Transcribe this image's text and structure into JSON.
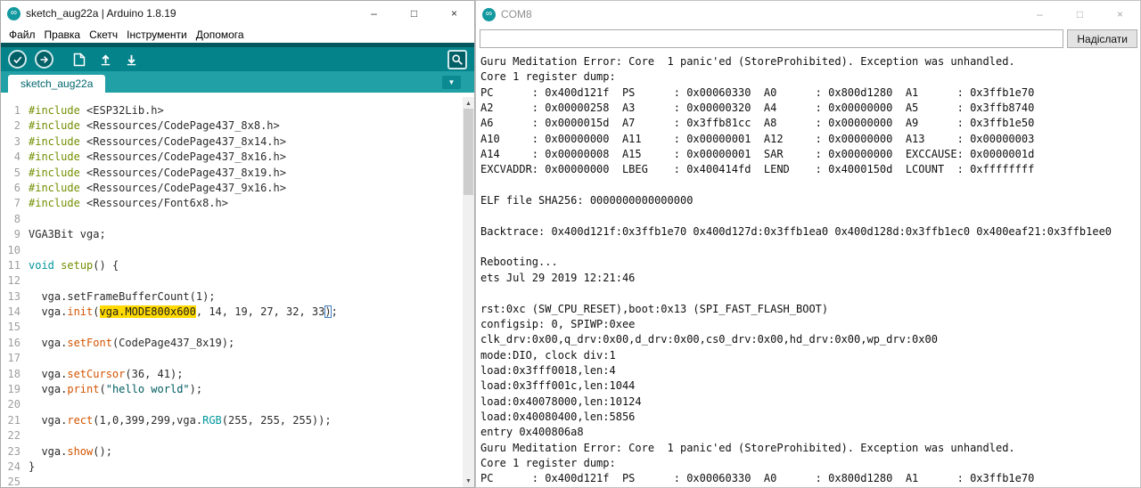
{
  "glyphs": {
    "infinity": "∞",
    "minimize": "–",
    "maximize": "□",
    "close": "×",
    "chevron_down": "▼",
    "scroll_up": "▲",
    "scroll_down": "▼"
  },
  "colors": {
    "toolbar_teal": "#04838A",
    "toolbar_dark_strip": "#02565C",
    "tabbar_teal": "#21A0A6",
    "keyword": "#00979C",
    "function": "#D35400",
    "directive": "#728E00",
    "string": "#005C5F",
    "selection_highlight": "#FFD900"
  },
  "ide": {
    "title": "sketch_aug22a | Arduino 1.8.19",
    "menu": [
      "Файл",
      "Правка",
      "Скетч",
      "Інструменти",
      "Допомога"
    ],
    "toolbar_buttons": [
      "verify",
      "upload",
      "new-sketch",
      "open",
      "save",
      "serial-monitor"
    ],
    "tab_label": "sketch_aug22a",
    "code_lines": [
      {
        "n": 1,
        "s": [
          [
            "d",
            "#include"
          ],
          [
            "p",
            " <ESP32Lib.h>"
          ]
        ]
      },
      {
        "n": 2,
        "s": [
          [
            "d",
            "#include"
          ],
          [
            "p",
            " <Ressources/CodePage437_8x8.h>"
          ]
        ]
      },
      {
        "n": 3,
        "s": [
          [
            "d",
            "#include"
          ],
          [
            "p",
            " <Ressources/CodePage437_8x14.h>"
          ]
        ]
      },
      {
        "n": 4,
        "s": [
          [
            "d",
            "#include"
          ],
          [
            "p",
            " <Ressources/CodePage437_8x16.h>"
          ]
        ]
      },
      {
        "n": 5,
        "s": [
          [
            "d",
            "#include"
          ],
          [
            "p",
            " <Ressources/CodePage437_8x19.h>"
          ]
        ]
      },
      {
        "n": 6,
        "s": [
          [
            "d",
            "#include"
          ],
          [
            "p",
            " <Ressources/CodePage437_9x16.h>"
          ]
        ]
      },
      {
        "n": 7,
        "s": [
          [
            "d",
            "#include"
          ],
          [
            "p",
            " <Ressources/Font6x8.h>"
          ]
        ]
      },
      {
        "n": 8,
        "s": []
      },
      {
        "n": 9,
        "s": [
          [
            "p",
            "VGA3Bit vga;"
          ]
        ]
      },
      {
        "n": 10,
        "s": []
      },
      {
        "n": 11,
        "s": [
          [
            "k",
            "void"
          ],
          [
            "p",
            " "
          ],
          [
            "d",
            "setup"
          ],
          [
            "p",
            "() {"
          ]
        ]
      },
      {
        "n": 12,
        "s": []
      },
      {
        "n": 13,
        "s": [
          [
            "p",
            "  vga.setFrameBufferCount(1);"
          ]
        ]
      },
      {
        "n": 14,
        "s": [
          [
            "p",
            "  vga."
          ],
          [
            "f",
            "init"
          ],
          [
            "p",
            "("
          ],
          [
            "h",
            "vga.MODE800x600"
          ],
          [
            "p",
            ", 14, 19, 27, 32, 33"
          ],
          [
            "b",
            ")"
          ],
          [
            "p",
            ";"
          ]
        ]
      },
      {
        "n": 15,
        "s": []
      },
      {
        "n": 16,
        "s": [
          [
            "p",
            "  vga."
          ],
          [
            "f",
            "setFont"
          ],
          [
            "p",
            "(CodePage437_8x19);"
          ]
        ]
      },
      {
        "n": 17,
        "s": []
      },
      {
        "n": 18,
        "s": [
          [
            "p",
            "  vga."
          ],
          [
            "f",
            "setCursor"
          ],
          [
            "p",
            "(36, 41);"
          ]
        ]
      },
      {
        "n": 19,
        "s": [
          [
            "p",
            "  vga."
          ],
          [
            "f",
            "print"
          ],
          [
            "p",
            "("
          ],
          [
            "s",
            "\"hello world\""
          ],
          [
            "p",
            ");"
          ]
        ]
      },
      {
        "n": 20,
        "s": []
      },
      {
        "n": 21,
        "s": [
          [
            "p",
            "  vga."
          ],
          [
            "f",
            "rect"
          ],
          [
            "p",
            "(1,0,399,299,vga."
          ],
          [
            "k",
            "RGB"
          ],
          [
            "p",
            "(255, 255, 255));"
          ]
        ]
      },
      {
        "n": 22,
        "s": []
      },
      {
        "n": 23,
        "s": [
          [
            "p",
            "  vga."
          ],
          [
            "f",
            "show"
          ],
          [
            "p",
            "();"
          ]
        ]
      },
      {
        "n": 24,
        "s": [
          [
            "p",
            "}"
          ]
        ]
      },
      {
        "n": 25,
        "s": []
      }
    ]
  },
  "serial": {
    "title": "COM8",
    "send_label": "Надіслати",
    "input_value": "",
    "lines": [
      "Guru Meditation Error: Core  1 panic'ed (StoreProhibited). Exception was unhandled.",
      "Core 1 register dump:",
      "PC      : 0x400d121f  PS      : 0x00060330  A0      : 0x800d1280  A1      : 0x3ffb1e70",
      "A2      : 0x00000258  A3      : 0x00000320  A4      : 0x00000000  A5      : 0x3ffb8740",
      "A6      : 0x0000015d  A7      : 0x3ffb81cc  A8      : 0x00000000  A9      : 0x3ffb1e50",
      "A10     : 0x00000000  A11     : 0x00000001  A12     : 0x00000000  A13     : 0x00000003",
      "A14     : 0x00000008  A15     : 0x00000001  SAR     : 0x00000000  EXCCAUSE: 0x0000001d",
      "EXCVADDR: 0x00000000  LBEG    : 0x400414fd  LEND    : 0x4000150d  LCOUNT  : 0xffffffff",
      "",
      "ELF file SHA256: 0000000000000000",
      "",
      "Backtrace: 0x400d121f:0x3ffb1e70 0x400d127d:0x3ffb1ea0 0x400d128d:0x3ffb1ec0 0x400eaf21:0x3ffb1ee0",
      "",
      "Rebooting...",
      "ets Jul 29 2019 12:21:46",
      "",
      "rst:0xc (SW_CPU_RESET),boot:0x13 (SPI_FAST_FLASH_BOOT)",
      "configsip: 0, SPIWP:0xee",
      "clk_drv:0x00,q_drv:0x00,d_drv:0x00,cs0_drv:0x00,hd_drv:0x00,wp_drv:0x00",
      "mode:DIO, clock div:1",
      "load:0x3fff0018,len:4",
      "load:0x3fff001c,len:1044",
      "load:0x40078000,len:10124",
      "load:0x40080400,len:5856",
      "entry 0x400806a8",
      "Guru Meditation Error: Core  1 panic'ed (StoreProhibited). Exception was unhandled.",
      "Core 1 register dump:",
      "PC      : 0x400d121f  PS      : 0x00060330  A0      : 0x800d1280  A1      : 0x3ffb1e70"
    ]
  }
}
